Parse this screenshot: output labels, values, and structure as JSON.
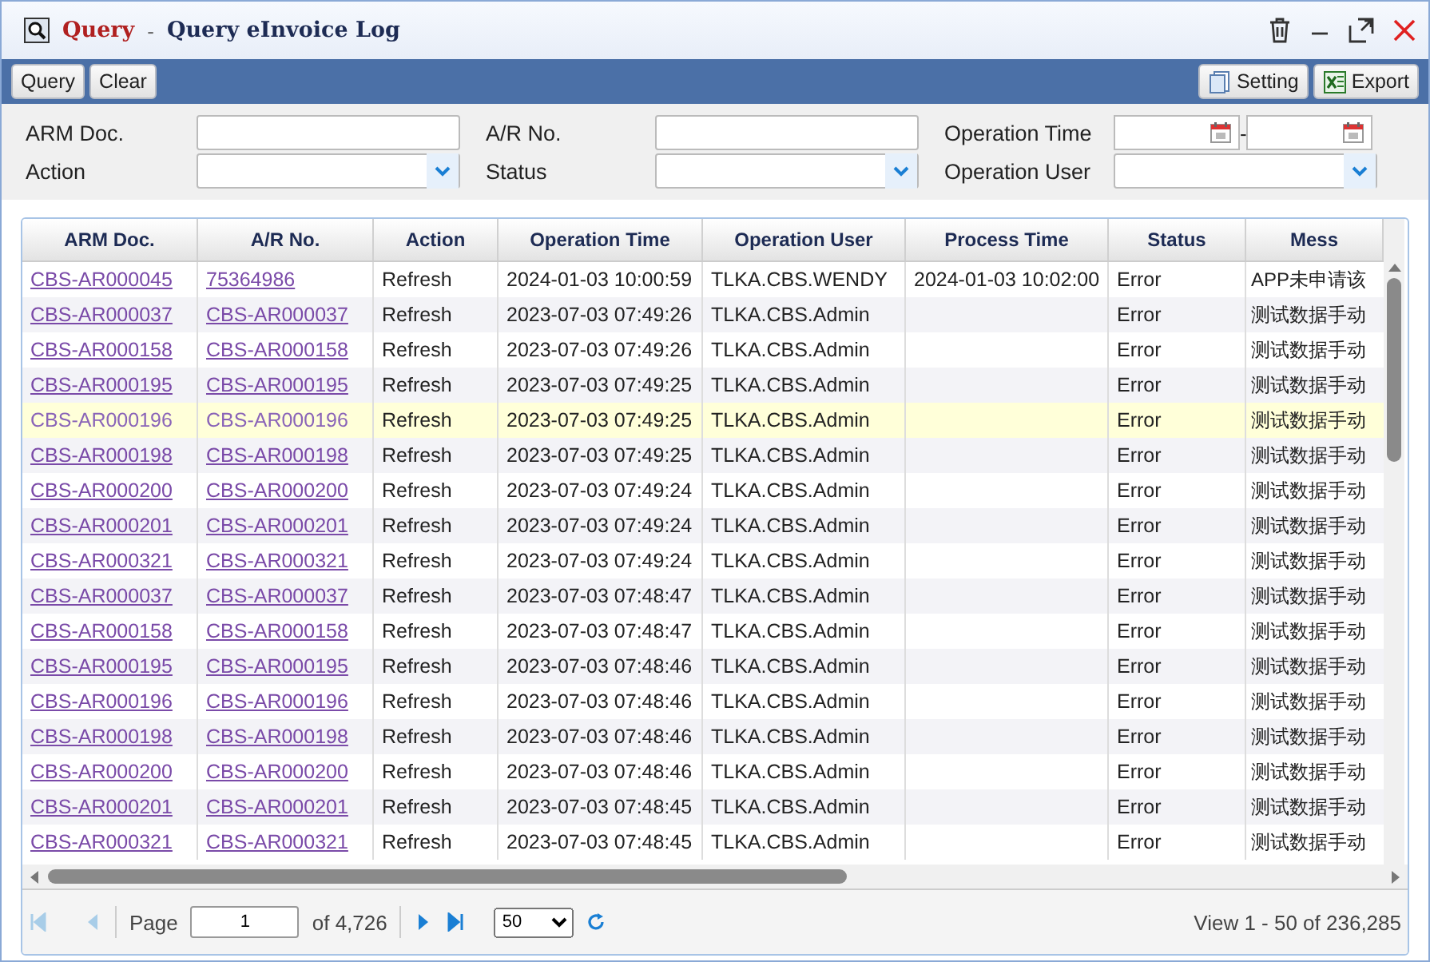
{
  "window": {
    "title_prefix": "Query",
    "title_separator": "-",
    "title": "Query eInvoice Log"
  },
  "toolbar": {
    "left": [
      "Query",
      "Clear"
    ],
    "right": [
      {
        "label": "Setting",
        "kind": "setting"
      },
      {
        "label": "Export",
        "kind": "excel"
      }
    ]
  },
  "filters": [
    {
      "label": "ARM Doc.",
      "kind": "text"
    },
    {
      "label": "A/R No.",
      "kind": "text"
    },
    {
      "label": "Operation Time",
      "kind": "daterange",
      "separator": "-"
    },
    {
      "label": "Action",
      "kind": "select"
    },
    {
      "label": "Status",
      "kind": "select"
    },
    {
      "label": "Operation User",
      "kind": "select"
    }
  ],
  "table": {
    "columns": [
      "ARM Doc.",
      "A/R No.",
      "Action",
      "Operation Time",
      "Operation User",
      "Process Time",
      "Status",
      "Mess"
    ],
    "rows": [
      {
        "arm_doc": "CBS-AR000045",
        "ar_no": "75364986",
        "action": "Refresh",
        "operation_time": "2024-01-03 10:00:59",
        "operation_user": "TLKA.CBS.WENDY",
        "process_time": "2024-01-03 10:02:00",
        "status": "Error",
        "message": "APP未申请该",
        "selected": false
      },
      {
        "arm_doc": "CBS-AR000037",
        "ar_no": "CBS-AR000037",
        "action": "Refresh",
        "operation_time": "2023-07-03 07:49:26",
        "operation_user": "TLKA.CBS.Admin",
        "status": "Error",
        "message": "测试数据手动",
        "selected": false
      },
      {
        "arm_doc": "CBS-AR000158",
        "ar_no": "CBS-AR000158",
        "action": "Refresh",
        "operation_time": "2023-07-03 07:49:26",
        "operation_user": "TLKA.CBS.Admin",
        "status": "Error",
        "message": "测试数据手动",
        "selected": false
      },
      {
        "arm_doc": "CBS-AR000195",
        "ar_no": "CBS-AR000195",
        "action": "Refresh",
        "operation_time": "2023-07-03 07:49:25",
        "operation_user": "TLKA.CBS.Admin",
        "status": "Error",
        "message": "测试数据手动",
        "selected": false
      },
      {
        "arm_doc": "CBS-AR000196",
        "ar_no": "CBS-AR000196",
        "action": "Refresh",
        "operation_time": "2023-07-03 07:49:25",
        "operation_user": "TLKA.CBS.Admin",
        "status": "Error",
        "message": "测试数据手动",
        "selected": true
      },
      {
        "arm_doc": "CBS-AR000198",
        "ar_no": "CBS-AR000198",
        "action": "Refresh",
        "operation_time": "2023-07-03 07:49:25",
        "operation_user": "TLKA.CBS.Admin",
        "status": "Error",
        "message": "测试数据手动",
        "selected": false
      },
      {
        "arm_doc": "CBS-AR000200",
        "ar_no": "CBS-AR000200",
        "action": "Refresh",
        "operation_time": "2023-07-03 07:49:24",
        "operation_user": "TLKA.CBS.Admin",
        "status": "Error",
        "message": "测试数据手动",
        "selected": false
      },
      {
        "arm_doc": "CBS-AR000201",
        "ar_no": "CBS-AR000201",
        "action": "Refresh",
        "operation_time": "2023-07-03 07:49:24",
        "operation_user": "TLKA.CBS.Admin",
        "status": "Error",
        "message": "测试数据手动",
        "selected": false
      },
      {
        "arm_doc": "CBS-AR000321",
        "ar_no": "CBS-AR000321",
        "action": "Refresh",
        "operation_time": "2023-07-03 07:49:24",
        "operation_user": "TLKA.CBS.Admin",
        "status": "Error",
        "message": "测试数据手动",
        "selected": false
      },
      {
        "arm_doc": "CBS-AR000037",
        "ar_no": "CBS-AR000037",
        "action": "Refresh",
        "operation_time": "2023-07-03 07:48:47",
        "operation_user": "TLKA.CBS.Admin",
        "status": "Error",
        "message": "测试数据手动",
        "selected": false
      },
      {
        "arm_doc": "CBS-AR000158",
        "ar_no": "CBS-AR000158",
        "action": "Refresh",
        "operation_time": "2023-07-03 07:48:47",
        "operation_user": "TLKA.CBS.Admin",
        "status": "Error",
        "message": "测试数据手动",
        "selected": false
      },
      {
        "arm_doc": "CBS-AR000195",
        "ar_no": "CBS-AR000195",
        "action": "Refresh",
        "operation_time": "2023-07-03 07:48:46",
        "operation_user": "TLKA.CBS.Admin",
        "status": "Error",
        "message": "测试数据手动",
        "selected": false
      },
      {
        "arm_doc": "CBS-AR000196",
        "ar_no": "CBS-AR000196",
        "action": "Refresh",
        "operation_time": "2023-07-03 07:48:46",
        "operation_user": "TLKA.CBS.Admin",
        "status": "Error",
        "message": "测试数据手动",
        "selected": false
      },
      {
        "arm_doc": "CBS-AR000198",
        "ar_no": "CBS-AR000198",
        "action": "Refresh",
        "operation_time": "2023-07-03 07:48:46",
        "operation_user": "TLKA.CBS.Admin",
        "status": "Error",
        "message": "测试数据手动",
        "selected": false
      },
      {
        "arm_doc": "CBS-AR000200",
        "ar_no": "CBS-AR000200",
        "action": "Refresh",
        "operation_time": "2023-07-03 07:48:46",
        "operation_user": "TLKA.CBS.Admin",
        "status": "Error",
        "message": "测试数据手动",
        "selected": false
      },
      {
        "arm_doc": "CBS-AR000201",
        "ar_no": "CBS-AR000201",
        "action": "Refresh",
        "operation_time": "2023-07-03 07:48:45",
        "operation_user": "TLKA.CBS.Admin",
        "status": "Error",
        "message": "测试数据手动",
        "selected": false
      },
      {
        "arm_doc": "CBS-AR000321",
        "ar_no": "CBS-AR000321",
        "action": "Refresh",
        "operation_time": "2023-07-03 07:48:45",
        "operation_user": "TLKA.CBS.Admin",
        "status": "Error",
        "message": "测试数据手动",
        "selected": false
      }
    ]
  },
  "pager": {
    "page_label": "Page",
    "page_value": "1",
    "page_total": "of 4,726",
    "page_size": "50",
    "summary": "View 1 - 50 of 236,285"
  }
}
